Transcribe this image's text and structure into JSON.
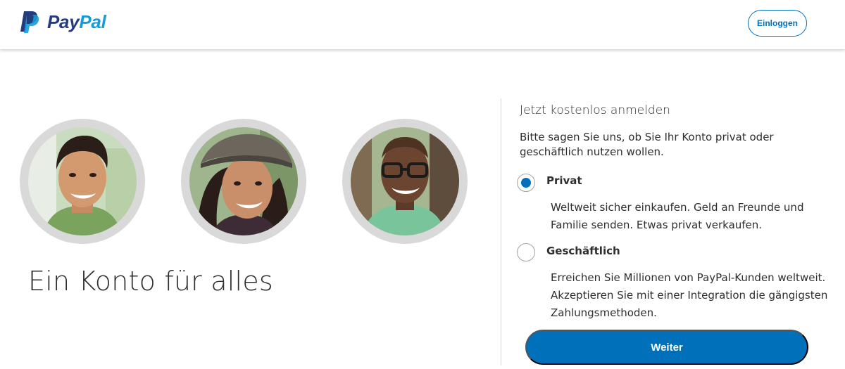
{
  "header": {
    "brand_pay": "Pay",
    "brand_pal": "Pal",
    "login_label": "Einloggen"
  },
  "hero": {
    "title": "Ein Konto für alles"
  },
  "signup": {
    "title": "Jetzt kostenlos anmelden",
    "description": "Bitte sagen Sie uns, ob Sie Ihr Konto privat oder geschäftlich nutzen wollen.",
    "options": [
      {
        "label": "Privat",
        "description": "Weltweit sicher einkaufen. Geld an Freunde und Familie senden. Etwas privat verkaufen.",
        "selected": true
      },
      {
        "label": "Geschäftlich",
        "description": "Erreichen Sie Millionen von PayPal-Kunden weltweit. Akzeptieren Sie mit einer Integration die gängigsten Zahlungsmethoden.",
        "selected": false
      }
    ],
    "continue_label": "Weiter"
  },
  "colors": {
    "brand_dark": "#253b80",
    "brand_light": "#179bd7",
    "accent": "#0070ba"
  },
  "icons": {
    "logo": "paypal-logo-icon",
    "avatars": [
      "person-photo",
      "person-photo",
      "person-photo"
    ]
  }
}
